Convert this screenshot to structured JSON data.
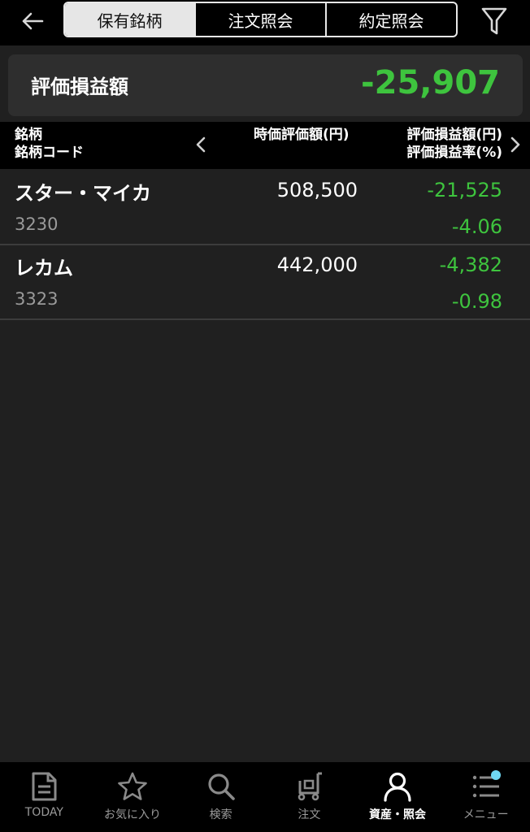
{
  "header": {
    "tabs": [
      {
        "label": "保有銘柄",
        "active": true
      },
      {
        "label": "注文照会",
        "active": false
      },
      {
        "label": "約定照会",
        "active": false
      }
    ]
  },
  "summary": {
    "label": "評価損益額",
    "value": "-25,907"
  },
  "columns": {
    "name_line1": "銘柄",
    "name_line2": "銘柄コード",
    "value_header": "時価評価額(円)",
    "pl_line1": "評価損益額(円)",
    "pl_line2": "評価損益率(%)"
  },
  "holdings": [
    {
      "name": "スター・マイカ",
      "code": "3230",
      "market_value": "508,500",
      "pl_amount": "-21,525",
      "pl_rate": "-4.06"
    },
    {
      "name": "レカム",
      "code": "3323",
      "market_value": "442,000",
      "pl_amount": "-4,382",
      "pl_rate": "-0.98"
    }
  ],
  "nav": [
    {
      "label": "TODAY",
      "icon": "today-icon"
    },
    {
      "label": "お気に入り",
      "icon": "star-icon"
    },
    {
      "label": "検索",
      "icon": "search-icon"
    },
    {
      "label": "注文",
      "icon": "cart-icon"
    },
    {
      "label": "資産・照会",
      "icon": "person-icon",
      "active": true
    },
    {
      "label": "メニュー",
      "icon": "menu-icon"
    }
  ],
  "colors": {
    "negative_green": "#3ec43e",
    "badge": "#6fd7f2",
    "background": "#202020"
  }
}
